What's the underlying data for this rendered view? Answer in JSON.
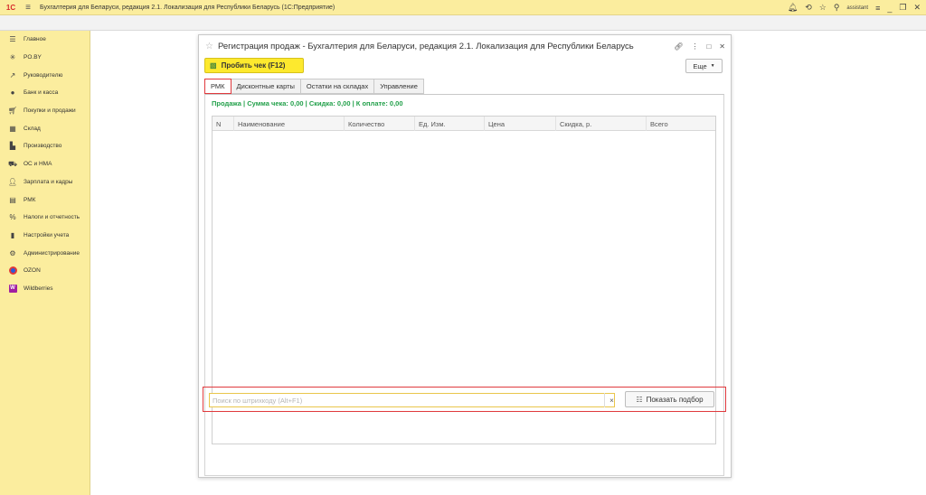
{
  "app": {
    "logo": "1С",
    "title": "Бухгалтерия для Беларуси, редакция 2.1. Локализация для Республики Беларусь   (1С:Предприятие)",
    "user": "assistant"
  },
  "sidebar": {
    "items": [
      {
        "label": "Главное",
        "icon": "menu-lines-icon"
      },
      {
        "label": "PO.BY",
        "icon": "sun-icon"
      },
      {
        "label": "Руководителю",
        "icon": "trend-icon"
      },
      {
        "label": "Банк и касса",
        "icon": "coins-icon"
      },
      {
        "label": "Покупки и продажи",
        "icon": "cart-icon"
      },
      {
        "label": "Склад",
        "icon": "warehouse-icon"
      },
      {
        "label": "Производство",
        "icon": "factory-icon"
      },
      {
        "label": "ОС и НМА",
        "icon": "truck-icon"
      },
      {
        "label": "Зарплата и кадры",
        "icon": "person-icon"
      },
      {
        "label": "РМК",
        "icon": "register-icon"
      },
      {
        "label": "Налоги и отчетность",
        "icon": "percent-icon"
      },
      {
        "label": "Настройки учета",
        "icon": "book-icon"
      },
      {
        "label": "Администрирование",
        "icon": "gear-icon"
      },
      {
        "label": "OZON",
        "icon": "ozon-icon"
      },
      {
        "label": "Wildberries",
        "icon": "wildberries-icon"
      }
    ]
  },
  "form": {
    "title": "Регистрация продаж - Бухгалтерия для Беларуси, редакция 2.1. Локализация для Республики Беларусь",
    "print_receipt": "Пробить чек (F12)",
    "more": "Еще",
    "tabs": [
      "РМК",
      "Дисконтные карты",
      "Остатки на складах",
      "Управление"
    ],
    "active_tab": "РМК",
    "summary": "Продажа | Сумма чека: 0,00 | Скидка: 0,00 | К оплате: 0,00",
    "columns": [
      "N",
      "Наименование",
      "Количество",
      "Ед. Изм.",
      "Цена",
      "Скидка, р.",
      "Всего"
    ],
    "rows": [],
    "search_placeholder": "Поиск по штрихкоду (Alt+F1)",
    "clear": "×",
    "show_selection": "Показать подбор"
  },
  "colors": {
    "topbar": "#fbed9e",
    "sidebar": "#fbed9e",
    "primary_button": "#fde92e",
    "summary_text": "#22a04a",
    "highlight": "#e0393d"
  }
}
